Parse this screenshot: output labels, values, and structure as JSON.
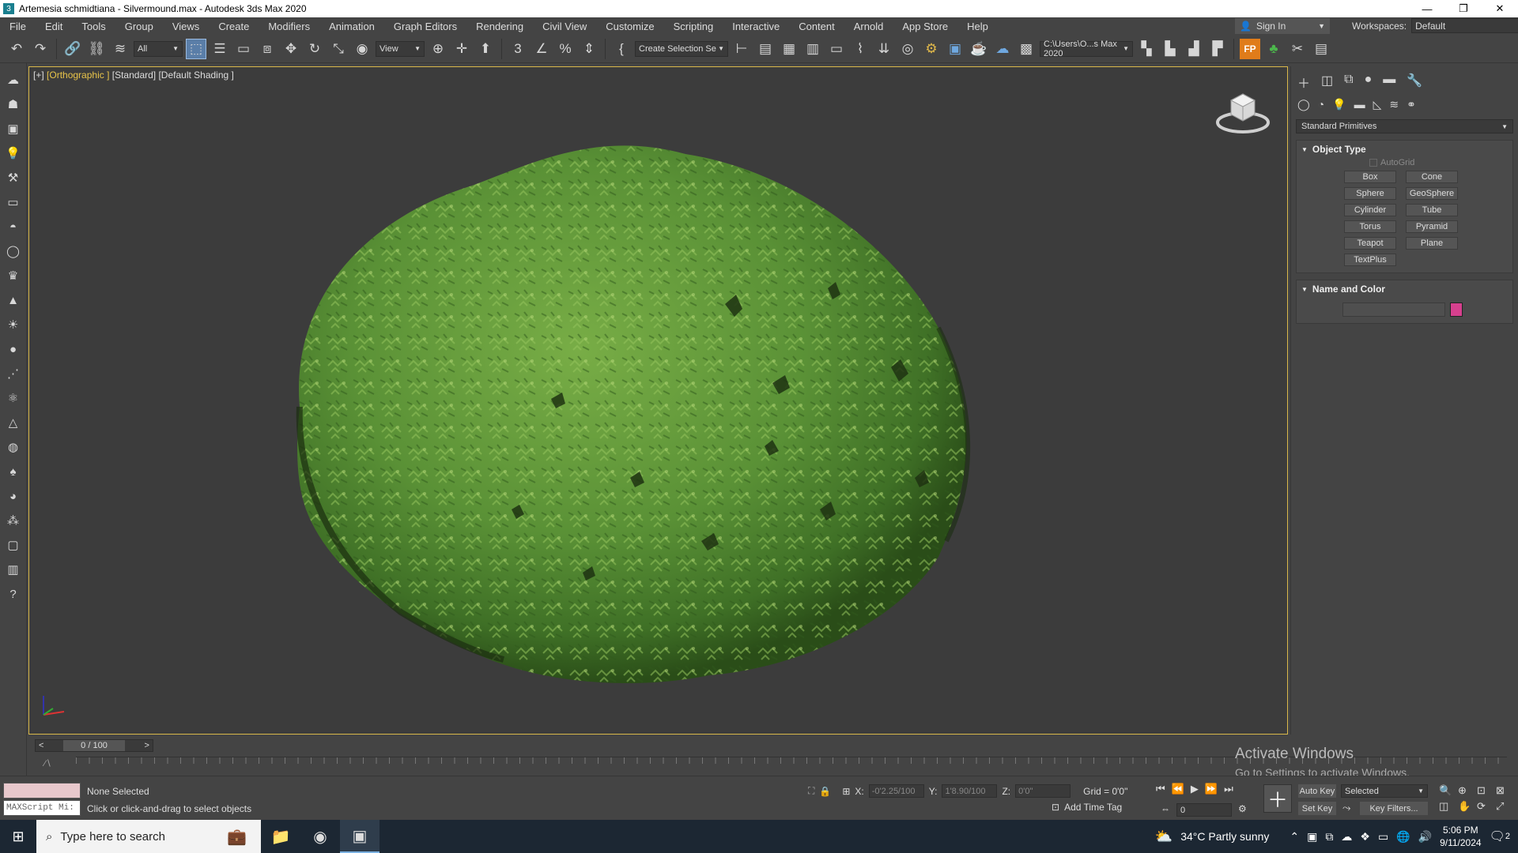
{
  "window": {
    "title": "Artemesia schmidtiana - Silvermound.max - Autodesk 3ds Max 2020",
    "minimize": "—",
    "maximize": "❐",
    "close": "✕"
  },
  "menu": {
    "items": [
      "File",
      "Edit",
      "Tools",
      "Group",
      "Views",
      "Create",
      "Modifiers",
      "Animation",
      "Graph Editors",
      "Rendering",
      "Civil View",
      "Customize",
      "Scripting",
      "Interactive",
      "Content",
      "Arnold",
      "App Store",
      "Help"
    ],
    "sign_in": "Sign In",
    "workspaces_label": "Workspaces:",
    "workspace_value": "Default"
  },
  "toolbar": {
    "selection_filter": "All",
    "ref_coord": "View",
    "named_selection": "Create Selection Se",
    "project_path": "C:\\Users\\O...s Max 2020"
  },
  "viewport": {
    "label_plus": "[+]",
    "label_view": "[Orthographic ]",
    "label_standard": "[Standard]",
    "label_shading": "[Default Shading ]"
  },
  "command_panel": {
    "dropdown": "Standard Primitives",
    "object_type_title": "Object Type",
    "autogrid": "AutoGrid",
    "buttons": [
      "Box",
      "Cone",
      "Sphere",
      "GeoSphere",
      "Cylinder",
      "Tube",
      "Torus",
      "Pyramid",
      "Teapot",
      "Plane",
      "TextPlus"
    ],
    "name_color_title": "Name and Color",
    "swatch_color": "#d6408e"
  },
  "timeline": {
    "frame_display": "0 / 100",
    "prev": "<",
    "next": ">"
  },
  "status": {
    "maxscript": "MAXScript Mi:",
    "none_selected": "None Selected",
    "prompt": "Click or click-and-drag to select objects",
    "x_label": "X:",
    "x_value": "-0'2.25/100",
    "y_label": "Y:",
    "y_value": "1'8.90/100",
    "z_label": "Z:",
    "z_value": "0'0\"",
    "grid": "Grid = 0'0\"",
    "add_time_tag": "Add Time Tag",
    "auto_key": "Auto Key",
    "set_key": "Set Key",
    "key_mode": "Selected",
    "key_filters": "Key Filters...",
    "frame": "0"
  },
  "watermark": {
    "line1": "Activate Windows",
    "line2": "Go to Settings to activate Windows."
  },
  "taskbar": {
    "search_placeholder": "Type here to search",
    "weather": "34°C  Partly sunny",
    "time": "5:06 PM",
    "date": "9/11/2024",
    "notif_count": "2"
  }
}
